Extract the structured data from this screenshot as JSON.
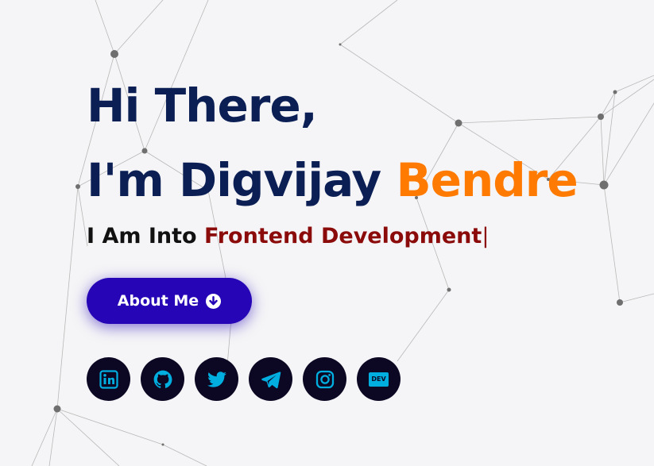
{
  "hero": {
    "greeting_line1": "Hi There,",
    "greeting_line2_prefix": "I'm Digvijay ",
    "greeting_line2_accent": "Bendre",
    "typing_prefix": "I Am Into ",
    "typing_text": "Frontend Development",
    "typing_caret": "|"
  },
  "about_button": {
    "label": "About Me",
    "icon": "arrow-circle-down-icon"
  },
  "socials": [
    {
      "name": "LinkedIn",
      "icon": "linkedin-icon"
    },
    {
      "name": "GitHub",
      "icon": "github-icon"
    },
    {
      "name": "Twitter",
      "icon": "twitter-icon"
    },
    {
      "name": "Telegram",
      "icon": "telegram-icon"
    },
    {
      "name": "Instagram",
      "icon": "instagram-icon"
    },
    {
      "name": "DEV",
      "icon": "dev-icon",
      "badge_text": "DEV"
    }
  ],
  "colors": {
    "background": "#f5f5f7",
    "heading": "#0b1f55",
    "accent": "#ff7a00",
    "typed": "#8b0a0a",
    "button": "#2505b5",
    "social_bg": "#0c0824",
    "social_icon": "#00aee0"
  }
}
